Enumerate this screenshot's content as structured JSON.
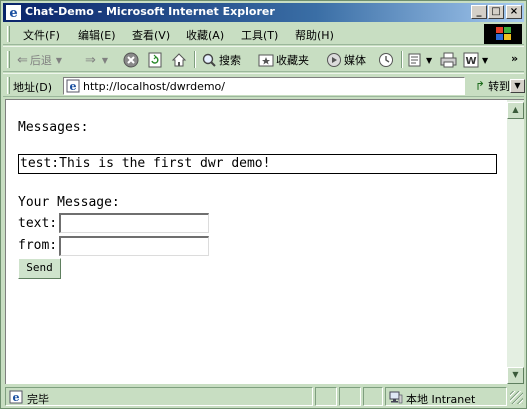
{
  "window": {
    "title": "Chat-Demo - Microsoft Internet Explorer",
    "minimize": "_",
    "maximize": "□",
    "close": "×"
  },
  "menu": {
    "items": [
      "文件(F)",
      "编辑(E)",
      "查看(V)",
      "收藏(A)",
      "工具(T)",
      "帮助(H)"
    ]
  },
  "toolbar": {
    "back": "后退",
    "search": "搜索",
    "favorites": "收藏夹",
    "media": "媒体",
    "more": "»"
  },
  "address": {
    "label": "地址(D)",
    "url": "http://localhost/dwrdemo/",
    "go": "转到"
  },
  "page": {
    "messages_label": "Messages:",
    "messages": [
      "test:This is the first dwr demo!"
    ],
    "your_message_label": "Your Message:",
    "text_label": "text:",
    "text_value": "",
    "from_label": "from:",
    "from_value": "",
    "send_label": "Send"
  },
  "status": {
    "text": "完毕",
    "zone": "本地 Intranet"
  }
}
